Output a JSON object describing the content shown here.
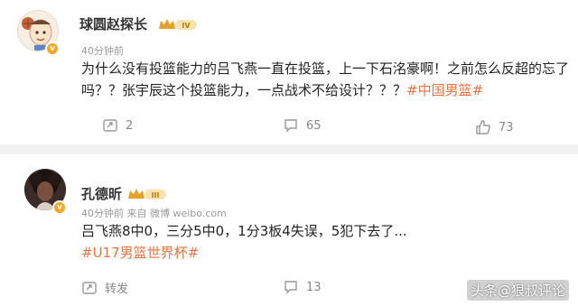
{
  "posts": [
    {
      "username": "球圆赵探长",
      "level_badge": "IV",
      "verified_badge": "v",
      "time": "40分钟前",
      "text": "为什么没有投篮能力的吕飞燕一直在投篮，上一下石洺豪啊！之前怎么反超的忘了吗？？张宇辰这个投篮能力，一点战术不给设计？？？",
      "hashtags": [
        "#中国男篮#"
      ],
      "actions": {
        "repost": "2",
        "comment": "65",
        "like": "73"
      }
    },
    {
      "username": "孔德昕",
      "level_badge": "III",
      "verified_badge": "v",
      "time": "40分钟前  来自 微博 weibo.com",
      "text": "吕飞燕8中0，三分5中0，1分3板4失误，5犯下去了...",
      "hashtags": [
        "#U17男篮世界杯#"
      ],
      "actions": {
        "repost": "转发",
        "comment": "",
        "like": "13"
      }
    }
  ],
  "watermark": "头条@狠叔评论",
  "colors": {
    "accent": "#eb7340",
    "badge": "#f5a623"
  }
}
